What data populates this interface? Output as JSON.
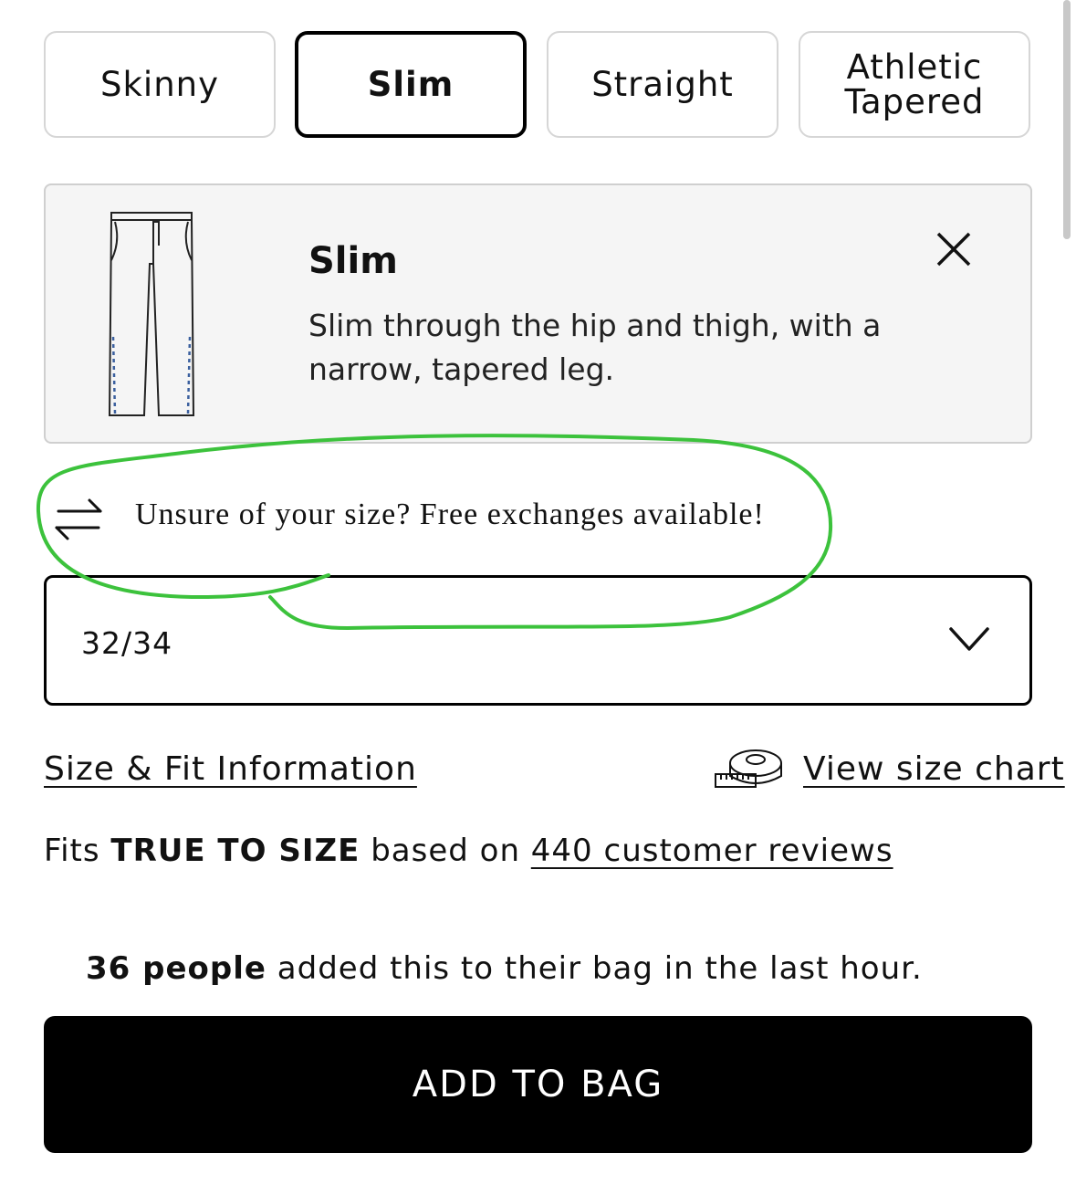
{
  "fit_tabs": [
    {
      "label": "Skinny",
      "selected": false
    },
    {
      "label": "Slim",
      "selected": true
    },
    {
      "label": "Straight",
      "selected": false
    },
    {
      "label": "Athletic\nTapered",
      "selected": false
    }
  ],
  "fit_panel": {
    "title": "Slim",
    "description": "Slim through the hip and thigh, with a narrow, tapered leg.",
    "illustration_icon": "pants-icon",
    "close_icon": "close-icon"
  },
  "exchange_note": {
    "icon": "exchange-arrows-icon",
    "text": "Unsure of your size? Free exchanges available!",
    "annotation_color": "#3cc23c"
  },
  "size_select": {
    "value": "32/34",
    "icon": "chevron-down-icon"
  },
  "links": {
    "size_fit": "Size & Fit Information",
    "size_chart": "View size chart",
    "size_chart_icon": "tape-measure-icon"
  },
  "fit_rating": {
    "prefix": "Fits ",
    "rating": "TRUE TO SIZE",
    "middle": " based on ",
    "reviews": "440 customer reviews"
  },
  "social_proof": {
    "count": "36 people",
    "text": " added this to their bag in the last hour."
  },
  "add_to_bag": {
    "label": "ADD TO BAG"
  },
  "colors": {
    "primary": "#000000",
    "panel_bg": "#f5f5f5",
    "border": "#d6d6d6",
    "annotation": "#3cc23c",
    "stitch": "#3a5f9e"
  }
}
